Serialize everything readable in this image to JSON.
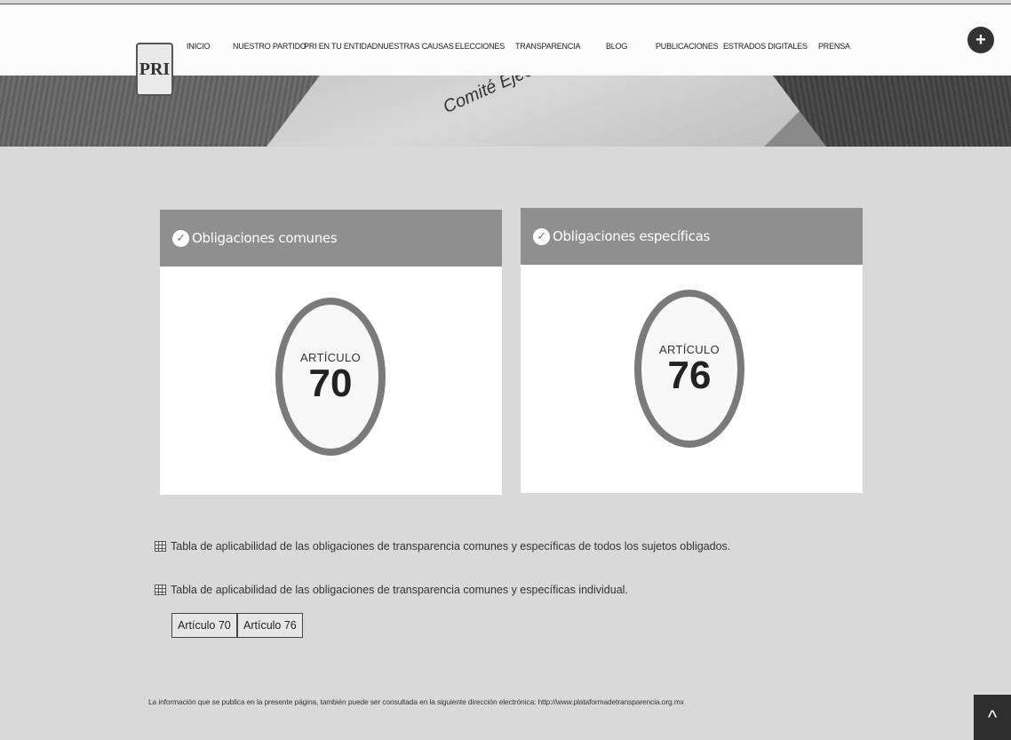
{
  "nav": {
    "items": [
      {
        "label": "INICIO"
      },
      {
        "label": "NUESTRO PARTIDO"
      },
      {
        "label": "PRI EN TU ENTIDAD"
      },
      {
        "label": "NUESTRAS CAUSAS"
      },
      {
        "label": "ELECCIONES"
      },
      {
        "label": "TRANSPARENCIA"
      },
      {
        "label": "BLOG"
      },
      {
        "label": "PUBLICACIONES"
      },
      {
        "label": "ESTRADOS DIGITALES"
      },
      {
        "label": "PRENSA"
      }
    ],
    "plus_label": "+"
  },
  "logo": {
    "text": "PRI"
  },
  "banner": {
    "text": "Comité Ejecu"
  },
  "cards": [
    {
      "title": "Obligaciones comunes",
      "ring_label": "ARTÍCULO",
      "ring_number": "70"
    },
    {
      "title": "Obligaciones específicas",
      "ring_label": "ARTÍCULO",
      "ring_number": "76"
    }
  ],
  "tables": {
    "all_subjects": "Tabla de aplicabilidad de las obligaciones de transparencia comunes y específicas de todos los sujetos obligados.",
    "individual": "Tabla de aplicabilidad de las obligaciones de transparencia comunes y específicas individual."
  },
  "buttons": {
    "art70": "Artículo 70",
    "art76": "Artículo 76"
  },
  "footer": {
    "text": "La información que se publica en la presente página, también puede ser consultada en la siguiente dirección electrónica: http://www.plataformadetransparencia.org.mx"
  },
  "scroll_top": {
    "label": "^"
  }
}
